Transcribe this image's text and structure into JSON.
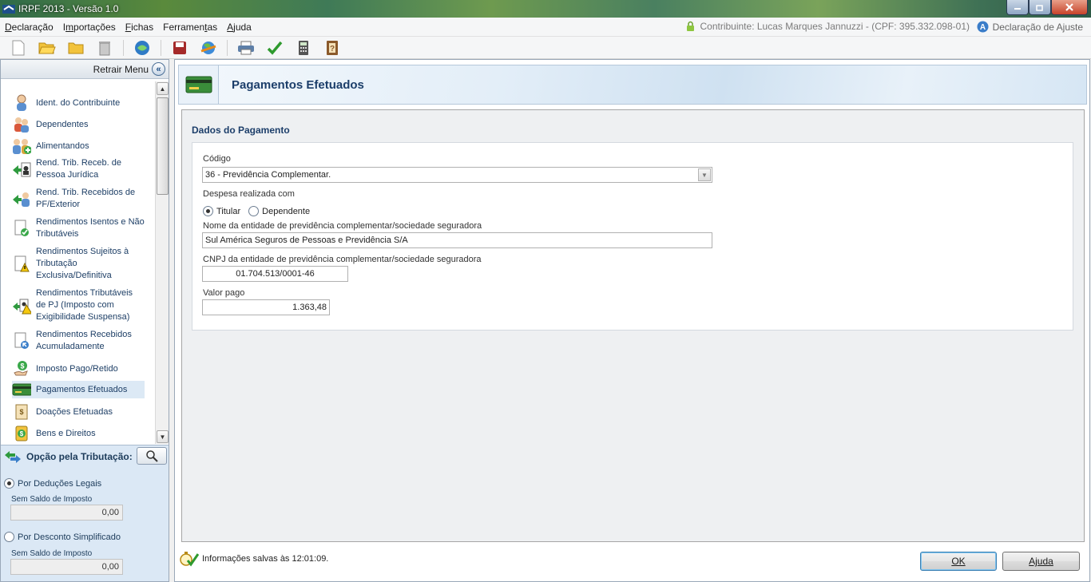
{
  "window": {
    "title": "IRPF 2013 - Versão 1.0"
  },
  "menu": {
    "items": [
      {
        "pre": "",
        "u": "D",
        "post": "eclaração"
      },
      {
        "pre": "I",
        "u": "m",
        "post": "portações"
      },
      {
        "pre": "",
        "u": "F",
        "post": "ichas"
      },
      {
        "pre": "Ferramen",
        "u": "t",
        "post": "as"
      },
      {
        "pre": "",
        "u": "A",
        "post": "juda"
      }
    ],
    "contribuinte": "Contribuinte: Lucas Marques Jannuzzi - (CPF: 395.332.098-01)",
    "declaracao": "Declaração de Ajuste"
  },
  "sidebar": {
    "retrair": "Retrair Menu",
    "items": [
      {
        "label": "Ident. do Contribuinte",
        "icon": "person-icon"
      },
      {
        "label": "Dependentes",
        "icon": "dependents-icon"
      },
      {
        "label": "Alimentandos",
        "icon": "alimentandos-icon"
      },
      {
        "label": "Rend. Trib. Receb. de Pessoa Jurídica",
        "icon": "rend-pj-icon"
      },
      {
        "label": "Rend. Trib. Recebidos de PF/Exterior",
        "icon": "rend-pf-icon"
      },
      {
        "label": "Rendimentos Isentos e Não Tributáveis",
        "icon": "document-check-icon"
      },
      {
        "label": "Rendimentos Sujeitos à Tributação Exclusiva/Definitiva",
        "icon": "document-warning-icon"
      },
      {
        "label": "Rendimentos Tributáveis de PJ (Imposto com Exigibilidade Suspensa)",
        "icon": "rend-suspensa-icon"
      },
      {
        "label": "Rendimentos Recebidos Acumuladamente",
        "icon": "document-arrow-icon"
      },
      {
        "label": "Imposto Pago/Retido",
        "icon": "hand-coin-icon"
      },
      {
        "label": "Pagamentos Efetuados",
        "icon": "card-icon"
      },
      {
        "label": "Doações Efetuadas",
        "icon": "donation-icon"
      },
      {
        "label": "Bens e Direitos",
        "icon": "coin-icon"
      }
    ],
    "opcao": {
      "title": "Opção pela Tributação:",
      "deducoes": {
        "label": "Por Deduções Legais",
        "sub": "Sem Saldo de Imposto",
        "value": "0,00"
      },
      "simplificado": {
        "label": "Por Desconto Simplificado",
        "sub": "Sem Saldo de Imposto",
        "value": "0,00"
      }
    }
  },
  "main": {
    "header": "Pagamentos Efetuados",
    "section": "Dados do Pagamento",
    "codigo_label": "Código",
    "codigo_value": "36 - Previdência Complementar.",
    "despesa_label": "Despesa realizada com",
    "titular": "Titular",
    "dependente": "Dependente",
    "nome_label": "Nome da entidade de previdência complementar/sociedade seguradora",
    "nome_value": "Sul América Seguros de Pessoas e Previdência S/A",
    "cnpj_label": "CNPJ da entidade de previdência complementar/sociedade seguradora",
    "cnpj_value": "01.704.513/0001-46",
    "valor_label": "Valor pago",
    "valor_value": "1.363,48",
    "status": "Informações salvas às 12:01:09.",
    "ok": "OK",
    "ajuda": "Ajuda"
  }
}
